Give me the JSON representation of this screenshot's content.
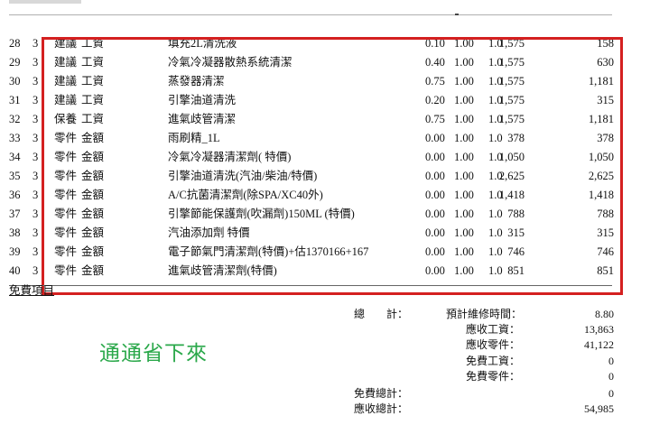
{
  "rows": [
    {
      "no": "28",
      "q": "3",
      "type": "建議",
      "cat": "工資",
      "name": "填充2L清洗液",
      "h": "0.10",
      "r": "1.00",
      "d": "1.0",
      "price": "1,575",
      "amount": "158"
    },
    {
      "no": "29",
      "q": "3",
      "type": "建議",
      "cat": "工資",
      "name": "冷氣冷凝器散熱系統清潔",
      "h": "0.40",
      "r": "1.00",
      "d": "1.0",
      "price": "1,575",
      "amount": "630"
    },
    {
      "no": "30",
      "q": "3",
      "type": "建議",
      "cat": "工資",
      "name": "蒸發器清潔",
      "h": "0.75",
      "r": "1.00",
      "d": "1.0",
      "price": "1,575",
      "amount": "1,181"
    },
    {
      "no": "31",
      "q": "3",
      "type": "建議",
      "cat": "工資",
      "name": "引擎油道清洗",
      "h": "0.20",
      "r": "1.00",
      "d": "1.0",
      "price": "1,575",
      "amount": "315"
    },
    {
      "no": "32",
      "q": "3",
      "type": "保養",
      "cat": "工資",
      "name": "進氣歧管清潔",
      "h": "0.75",
      "r": "1.00",
      "d": "1.0",
      "price": "1,575",
      "amount": "1,181"
    },
    {
      "no": "33",
      "q": "3",
      "type": "零件",
      "cat": "金額",
      "name": "雨刷精_1L",
      "h": "0.00",
      "r": "1.00",
      "d": "1.0",
      "price": "378",
      "amount": "378"
    },
    {
      "no": "34",
      "q": "3",
      "type": "零件",
      "cat": "金額",
      "name": "冷氣冷凝器清潔劑( 特價)",
      "h": "0.00",
      "r": "1.00",
      "d": "1.0",
      "price": "1,050",
      "amount": "1,050"
    },
    {
      "no": "35",
      "q": "3",
      "type": "零件",
      "cat": "金額",
      "name": "引擎油道清洗(汽油/柴油/特價)",
      "h": "0.00",
      "r": "1.00",
      "d": "1.0",
      "price": "2,625",
      "amount": "2,625"
    },
    {
      "no": "36",
      "q": "3",
      "type": "零件",
      "cat": "金額",
      "name": "A/C抗菌清潔劑(除SPA/XC40外)",
      "h": "0.00",
      "r": "1.00",
      "d": "1.0",
      "price": "1,418",
      "amount": "1,418"
    },
    {
      "no": "37",
      "q": "3",
      "type": "零件",
      "cat": "金額",
      "name": "引擎節能保護劑(吹漏劑)150ML (特價)",
      "h": "0.00",
      "r": "1.00",
      "d": "1.0",
      "price": "788",
      "amount": "788"
    },
    {
      "no": "38",
      "q": "3",
      "type": "零件",
      "cat": "金額",
      "name": "汽油添加劑 特價",
      "h": "0.00",
      "r": "1.00",
      "d": "1.0",
      "price": "315",
      "amount": "315"
    },
    {
      "no": "39",
      "q": "3",
      "type": "零件",
      "cat": "金額",
      "name": "電子節氣門清潔劑(特價)+估1370166+167",
      "h": "0.00",
      "r": "1.00",
      "d": "1.0",
      "price": "746",
      "amount": "746"
    },
    {
      "no": "40",
      "q": "3",
      "type": "零件",
      "cat": "金額",
      "name": "進氣歧管清潔劑(特價)",
      "h": "0.00",
      "r": "1.00",
      "d": "1.0",
      "price": "851",
      "amount": "851"
    }
  ],
  "free_items_label": "免費項目",
  "totals": {
    "total_label": "總　　計：",
    "est_hours_label": "預計維修時間：",
    "est_hours": "8.80",
    "labor_label": "應收工資：",
    "labor": "13,863",
    "parts_label": "應收零件：",
    "parts": "41,122",
    "free_labor_label": "免費工資：",
    "free_labor": "0",
    "free_parts_label": "免費零件：",
    "free_parts": "0",
    "free_total_label": "免費總計：",
    "free_total": "0",
    "receivable_label": "應收總計：",
    "receivable": "54,985"
  },
  "annotation": {
    "text": "通通省下來",
    "color": "#2aa84a"
  },
  "highlight_color": "#d42020"
}
